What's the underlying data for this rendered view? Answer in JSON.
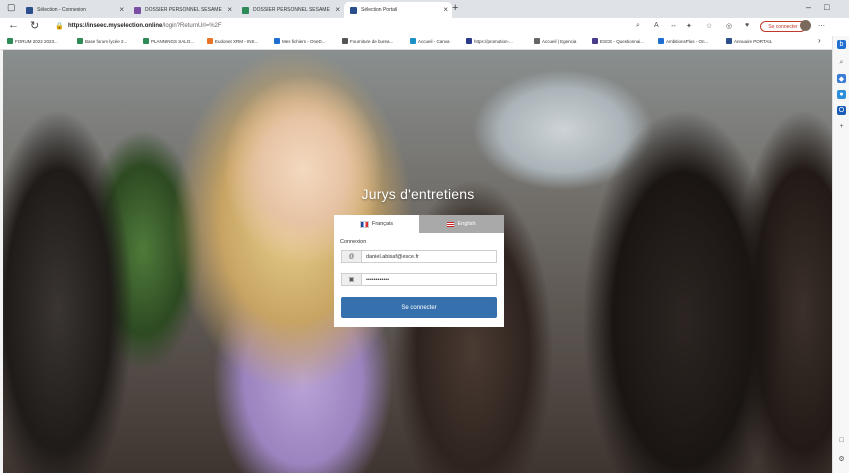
{
  "browser": {
    "tabs": [
      {
        "label": "Sélection - Connexion",
        "color": "#2b4e8c"
      },
      {
        "label": "DOSSIER PERSONNEL SESAME",
        "color": "#7a4fa3"
      },
      {
        "label": "DOSSIER PERSONNEL SESAME",
        "color": "#2e8b57"
      },
      {
        "label": "Sélection Portail",
        "color": "#2b4e8c"
      }
    ],
    "url_host": "https://inseec.myselection.online",
    "url_path": "/login?ReturnUrl=%2F",
    "signin_label": "Se connecter",
    "bookmarks": [
      {
        "label": "FORUM 2022 2023...",
        "color": "#2e8b57"
      },
      {
        "label": "Base forum lycée 2...",
        "color": "#2e8b57"
      },
      {
        "label": "PLANNINGS SALO...",
        "color": "#2e8b57"
      },
      {
        "label": "Eudonet XRM - INS...",
        "color": "#e8742a"
      },
      {
        "label": "Mes fichiers - OneD...",
        "color": "#1e6fd0"
      },
      {
        "label": "Fourniture de burea...",
        "color": "#555555"
      },
      {
        "label": "Accueil - Canva",
        "color": "#1e90c8"
      },
      {
        "label": "https://promotion-...",
        "color": "#2b3a8c"
      },
      {
        "label": "Accueil | Egencia",
        "color": "#666666"
      },
      {
        "label": "ESCE - Questionnai...",
        "color": "#4a3a8c"
      },
      {
        "label": "AmbitionsPlus - On...",
        "color": "#1e6fd0"
      },
      {
        "label": "Annuaire PORTAIL",
        "color": "#2b4e8c"
      }
    ]
  },
  "page": {
    "title": "Jurys d'entretiens",
    "lang_fr": "Français",
    "lang_en": "English",
    "section_label": "Connexion",
    "email_value": "daniel.abisaf@esce.fr",
    "password_value": "••••••••••••",
    "submit_label": "Se connecter"
  }
}
